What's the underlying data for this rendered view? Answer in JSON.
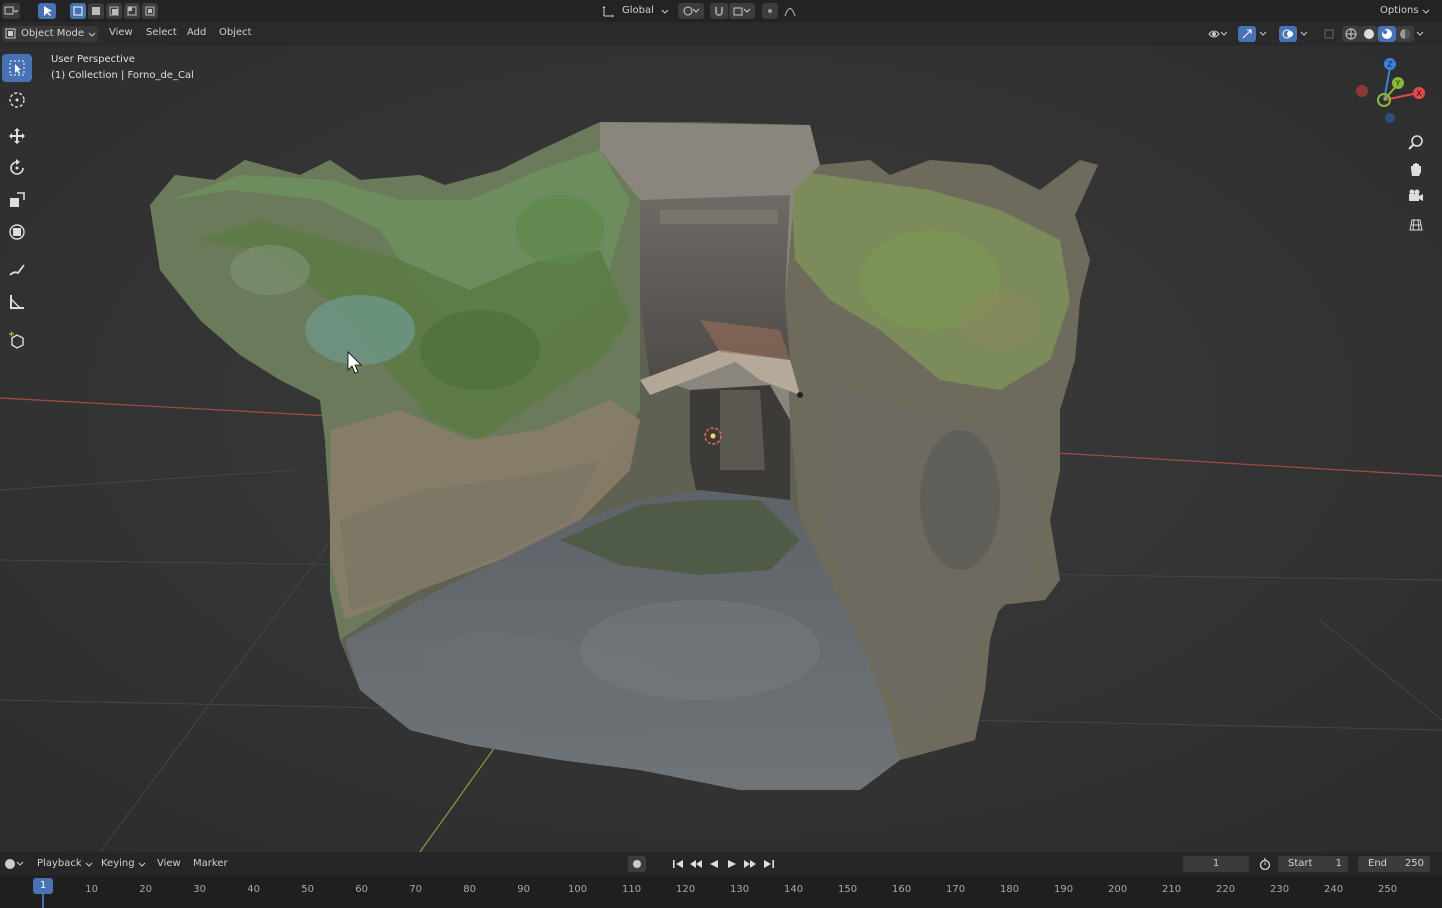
{
  "topbar": {
    "orientation_label": "Global",
    "options_label": "Options"
  },
  "header": {
    "mode_label": "Object Mode",
    "menu": [
      "View",
      "Select",
      "Add",
      "Object"
    ]
  },
  "viewport": {
    "perspective_label": "User Perspective",
    "collection_label": "(1) Collection | Forno_de_Cal",
    "gizmo": {
      "x_label": "X",
      "y_label": "Y",
      "z_label": "Z"
    }
  },
  "timeline": {
    "menu": [
      "Playback",
      "Keying",
      "View",
      "Marker"
    ],
    "current_frame": "1",
    "start_label": "Start",
    "start_value": "1",
    "end_label": "End",
    "end_value": "250",
    "ruler_current": "1",
    "ruler_ticks": [
      "10",
      "20",
      "30",
      "40",
      "50",
      "60",
      "70",
      "80",
      "90",
      "100",
      "110",
      "120",
      "130",
      "140",
      "150",
      "160",
      "170",
      "180",
      "190",
      "200",
      "210",
      "220",
      "230",
      "240",
      "250"
    ]
  },
  "icons": [
    "editor-type-icon",
    "select-tool-icon",
    "cursor-tool-icon",
    "move-tool-icon",
    "rotate-tool-icon",
    "scale-tool-icon",
    "transform-tool-icon",
    "annotate-tool-icon",
    "measure-tool-icon",
    "add-cube-tool-icon",
    "zoom-icon",
    "hand-pan-icon",
    "camera-icon",
    "grid-view-icon",
    "record-icon",
    "jump-start-icon",
    "prev-keyframe-icon",
    "play-reverse-icon",
    "play-icon",
    "next-keyframe-icon",
    "jump-end-icon",
    "stopwatch-icon",
    "mouse-cursor-icon"
  ],
  "colors": {
    "accent": "#4772b3",
    "x_axis": "#e24a4a",
    "y_axis": "#8ab83a",
    "z_axis": "#3b82e0"
  }
}
